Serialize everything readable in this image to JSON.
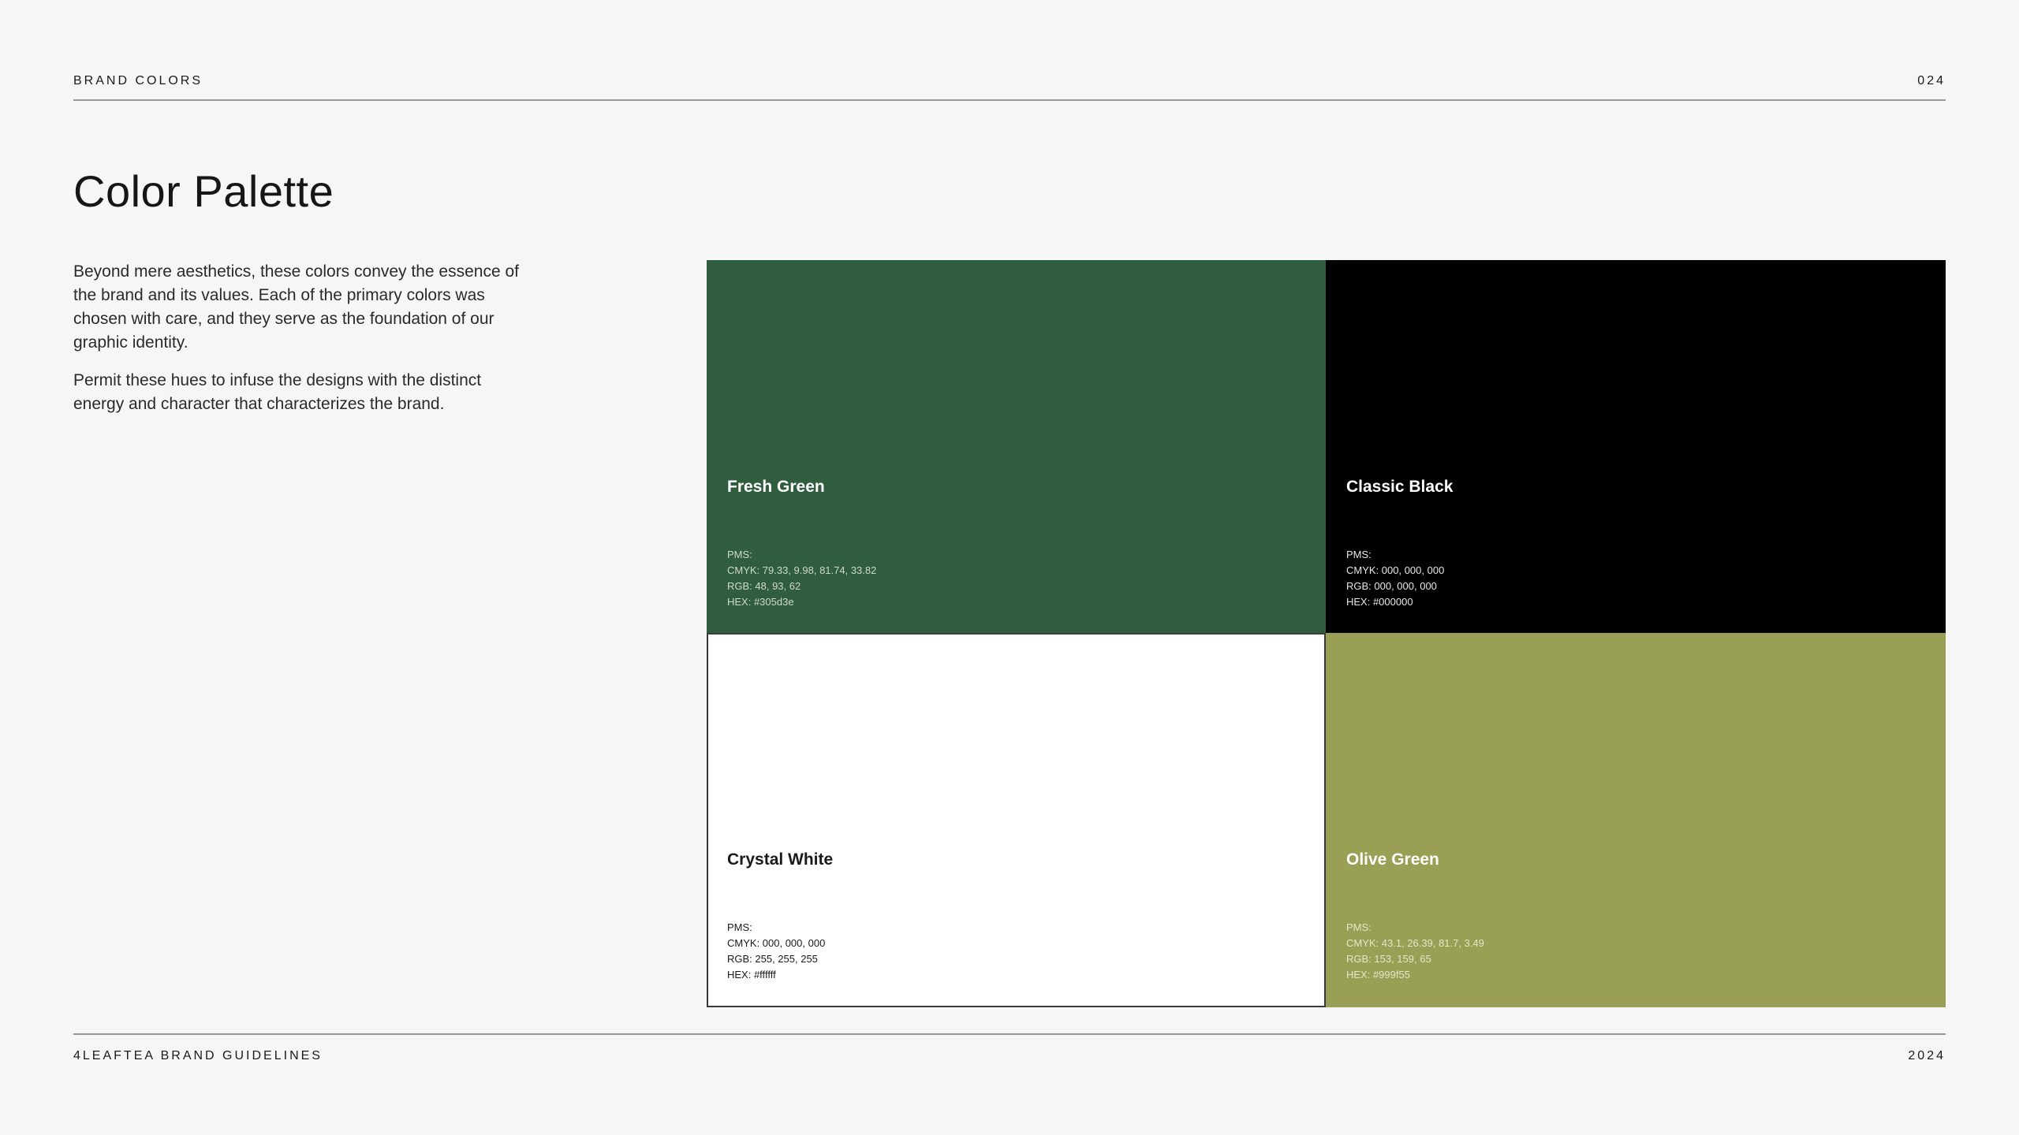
{
  "header": {
    "label": "BRAND COLORS",
    "page_number": "024"
  },
  "title": "Color Palette",
  "intro": {
    "paragraphs": [
      "Beyond mere aesthetics, these colors convey the essence of the brand and its values. Each of the primary colors was chosen with care, and they serve as the foundation of our graphic identity.",
      "Permit these hues to infuse the designs with the distinct energy and character that characterizes the brand."
    ]
  },
  "colors": [
    {
      "name": "Fresh Green",
      "pms": "PMS:",
      "cmyk": "CMYK: 79.33, 9.98, 81.74, 33.82",
      "rgb": "RGB: 48, 93, 62",
      "hex": "HEX: #305d3e",
      "swatch": "#305d3e"
    },
    {
      "name": "Classic Black",
      "pms": "PMS:",
      "cmyk": "CMYK: 000, 000, 000",
      "rgb": "RGB: 000, 000, 000",
      "hex": "HEX: #000000",
      "swatch": "#000000"
    },
    {
      "name": "Crystal White",
      "pms": "PMS:",
      "cmyk": "CMYK: 000, 000, 000",
      "rgb": "RGB: 255, 255, 255",
      "hex": "HEX: #ffffff",
      "swatch": "#ffffff"
    },
    {
      "name": "Olive Green",
      "pms": "PMS:",
      "cmyk": "CMYK: 43.1, 26.39, 81.7, 3.49",
      "rgb": "RGB: 153, 159, 65",
      "hex": "HEX: #999f55",
      "swatch": "#999f55"
    }
  ],
  "footer": {
    "label": "4LEAFTEA BRAND GUIDELINES",
    "year": "2024"
  }
}
